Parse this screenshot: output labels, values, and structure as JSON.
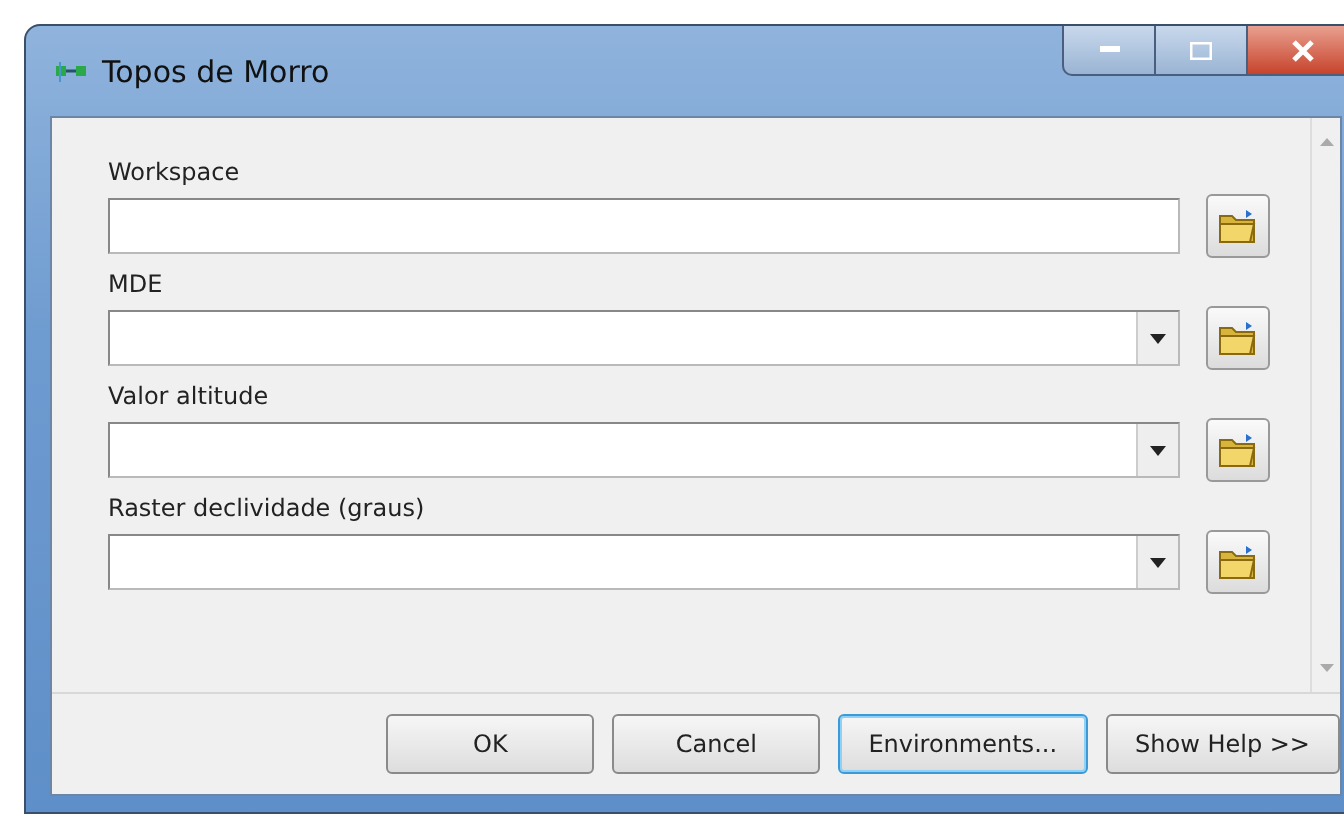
{
  "window": {
    "title": "Topos de Morro"
  },
  "parameters": [
    {
      "label": "Workspace",
      "kind": "text"
    },
    {
      "label": "MDE",
      "kind": "dropdown"
    },
    {
      "label": "Valor altitude",
      "kind": "dropdown"
    },
    {
      "label": "Raster declividade (graus)",
      "kind": "dropdown"
    }
  ],
  "buttons": [
    {
      "label": "OK",
      "focused": false
    },
    {
      "label": "Cancel",
      "focused": false
    },
    {
      "label": "Environments...",
      "focused": true
    },
    {
      "label": "Show Help >>",
      "focused": false
    }
  ]
}
